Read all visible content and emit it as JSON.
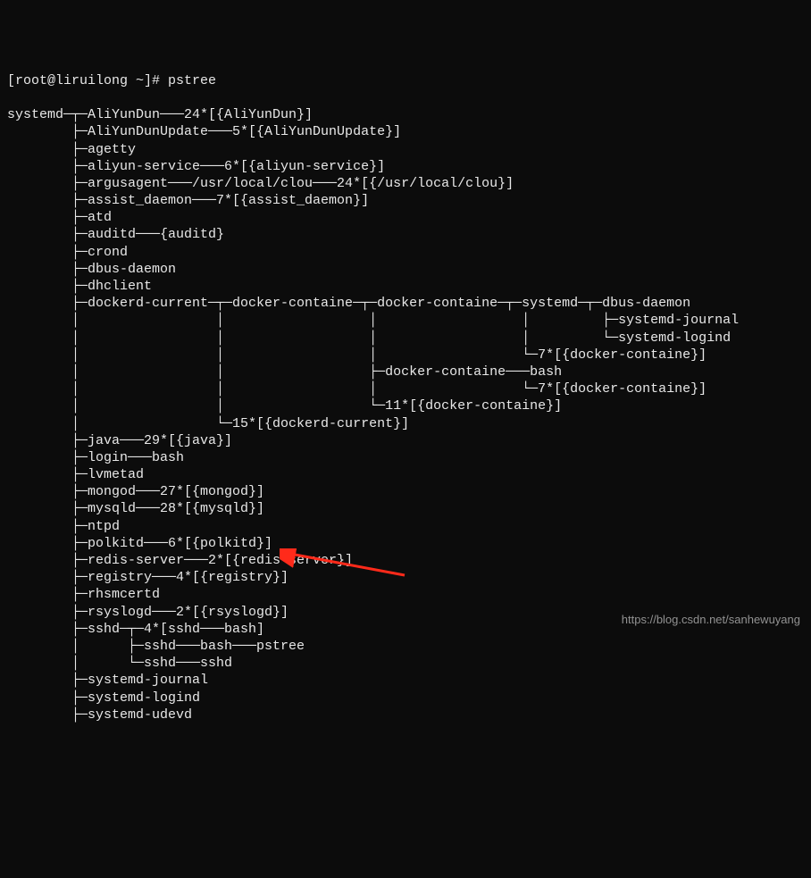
{
  "prompt": "[root@liruilong ~]# pstree",
  "lines": [
    "systemd─┬─AliYunDun───24*[{AliYunDun}]",
    "        ├─AliYunDunUpdate───5*[{AliYunDunUpdate}]",
    "        ├─agetty",
    "        ├─aliyun-service───6*[{aliyun-service}]",
    "        ├─argusagent───/usr/local/clou───24*[{/usr/local/clou}]",
    "        ├─assist_daemon───7*[{assist_daemon}]",
    "        ├─atd",
    "        ├─auditd───{auditd}",
    "        ├─crond",
    "        ├─dbus-daemon",
    "        ├─dhclient",
    "        ├─dockerd-current─┬─docker-containe─┬─docker-containe─┬─systemd─┬─dbus-daemon",
    "        │                 │                  │                  │         ├─systemd-journal",
    "        │                 │                  │                  │         └─systemd-logind",
    "        │                 │                  │                  └─7*[{docker-containe}]",
    "        │                 │                  ├─docker-containe───bash",
    "        │                 │                  │                  └─7*[{docker-containe}]",
    "        │                 │                  └─11*[{docker-containe}]",
    "        │                 └─15*[{dockerd-current}]",
    "        ├─java───29*[{java}]",
    "        ├─login───bash",
    "        ├─lvmetad",
    "        ├─mongod───27*[{mongod}]",
    "        ├─mysqld───28*[{mysqld}]",
    "        ├─ntpd",
    "        ├─polkitd───6*[{polkitd}]",
    "        ├─redis-server───2*[{redis-server}]",
    "        ├─registry───4*[{registry}]",
    "        ├─rhsmcertd",
    "        ├─rsyslogd───2*[{rsyslogd}]",
    "        ├─sshd─┬─4*[sshd───bash]",
    "        │      ├─sshd───bash───pstree",
    "        │      └─sshd───sshd",
    "        ├─systemd-journal",
    "        ├─systemd-logind",
    "        ├─systemd-udevd"
  ],
  "watermark": "https://blog.csdn.net/sanhewuyang",
  "arrow": {
    "color": "#ff2a1a"
  }
}
